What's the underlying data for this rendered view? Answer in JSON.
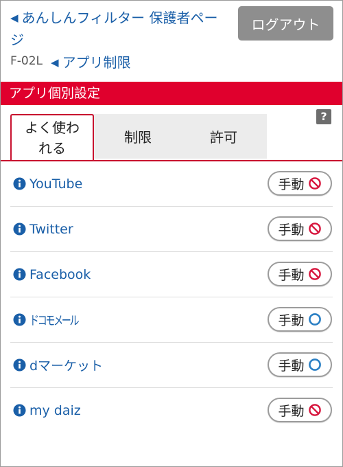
{
  "header": {
    "back_label": "あんしんフィルター 保護者ページ",
    "device_model": "F-02L",
    "sub_back_label": "アプリ制限",
    "logout_label": "ログアウト"
  },
  "section": {
    "title": "アプリ個別設定"
  },
  "tabs": [
    {
      "label": "よく使われる",
      "active": true
    },
    {
      "label": "制限",
      "active": false
    },
    {
      "label": "許可",
      "active": false
    }
  ],
  "help_label": "?",
  "apps": [
    {
      "name": "YouTube",
      "mode": "手動",
      "status": "restricted"
    },
    {
      "name": "Twitter",
      "mode": "手動",
      "status": "restricted"
    },
    {
      "name": "Facebook",
      "mode": "手動",
      "status": "restricted"
    },
    {
      "name": "ドコモメール",
      "mode": "手動",
      "status": "allowed"
    },
    {
      "name": "dマーケット",
      "mode": "手動",
      "status": "allowed"
    },
    {
      "name": "my daiz",
      "mode": "手動",
      "status": "restricted"
    }
  ],
  "colors": {
    "brand_red": "#e0002d",
    "link_blue": "#1a5fa8",
    "restricted_icon": "#d7143c",
    "allowed_icon": "#2a7fc4"
  },
  "icons": {
    "back": "triangle-left-icon",
    "help": "question-icon",
    "info": "info-icon",
    "restricted": "no-entry-icon",
    "allowed": "circle-icon"
  }
}
